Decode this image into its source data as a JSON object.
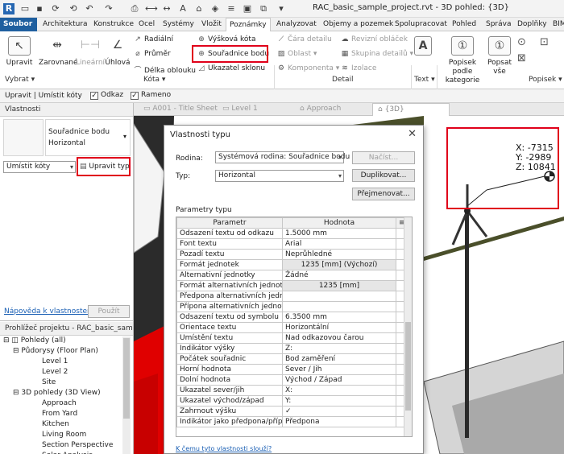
{
  "window": {
    "title": "RAC_basic_sample_project.rvt - 3D pohled: {3D}"
  },
  "tabs": [
    "Soubor",
    "Architektura",
    "Konstrukce",
    "Ocel",
    "Systémy",
    "Vložit",
    "Poznámky",
    "Analyzovat",
    "Objemy a pozemek",
    "Spolupracovat",
    "Pohled",
    "Správa",
    "Doplňky",
    "BIM"
  ],
  "active_tab": "Poznámky",
  "ribbon": {
    "upravit": "Upravit",
    "vybrat": "Vybrat",
    "kota": {
      "zarovnane": "Zarovnané",
      "linearni": "Lineární",
      "uhlova": "Úhlová",
      "radialni": "Radiální",
      "prumer": "Průměr",
      "delka_oblouku": "Délka oblouku",
      "vyskova_kota": "Výšková kóta",
      "souradnice_bodu": "Souřadnice bodu",
      "ukazatel_sklonu": "Ukazatel sklonu",
      "group": "Kóta"
    },
    "detail": {
      "cara_detailu": "Čára detailu",
      "oblast": "Oblast",
      "komponenta": "Komponenta",
      "revizni_oblacek": "Revizní obláček",
      "skupina_detailu": "Skupina detailů",
      "izolace": "Izolace",
      "group": "Detail"
    },
    "text": {
      "label": "Text",
      "group": "Text"
    },
    "popisek": {
      "podle_kategorie": "Popisek podle kategorie",
      "popsat_vse": "Popsat vše",
      "group": "Popisek"
    }
  },
  "options_bar": {
    "context": "Upravit | Umístit kóty",
    "odkaz": "Odkaz",
    "rameno": "Rameno"
  },
  "properties": {
    "title": "Vlastnosti",
    "type_name": "Souřadnice bodu",
    "type_sub": "Horizontal",
    "instance_select": "Umístit kóty",
    "edit_type": "Upravit typ",
    "help_link": "Nápověda k vlastnostem",
    "apply": "Použít"
  },
  "browser": {
    "title": "Prohlížeč projektu - RAC_basic_sampl...",
    "items": [
      "Pohledy (all)",
      "Půdorysy (Floor Plan)",
      "Level 1",
      "Level 2",
      "Site",
      "3D pohledy (3D View)",
      "Approach",
      "From Yard",
      "Kitchen",
      "Living Room",
      "Section Perspective",
      "Solar Analysis"
    ]
  },
  "view_tabs": [
    "A001 - Title Sheet",
    "Level 1",
    "Approach",
    "{3D}"
  ],
  "annotation": {
    "x": "X: -7315",
    "y": "Y: -2989",
    "z": "Z: 10841"
  },
  "dialog": {
    "title": "Vlastnosti typu",
    "rodina_label": "Rodina:",
    "rodina_value": "Systémová rodina: Souřadnice bodu",
    "typ_label": "Typ:",
    "typ_value": "Horizontal",
    "nacist": "Načíst...",
    "duplikovat": "Duplikovat...",
    "prejmenovat": "Přejmenovat...",
    "params_title": "Parametry typu",
    "col_param": "Parametr",
    "col_value": "Hodnota",
    "rows": [
      [
        "Odsazení textu od odkazu",
        "1.5000 mm"
      ],
      [
        "Font textu",
        "Arial"
      ],
      [
        "Pozadí textu",
        "Neprůhledné"
      ],
      [
        "Formát jednotek",
        "1235 [mm] (Výchozí)"
      ],
      [
        "Alternativní jednotky",
        "Žádné"
      ],
      [
        "Formát alternativních jednotek",
        "1235 [mm]"
      ],
      [
        "Předpona alternativních jednotek",
        ""
      ],
      [
        "Přípona alternativních jednotek",
        ""
      ],
      [
        "Odsazení textu od symbolu",
        "6.3500 mm"
      ],
      [
        "Orientace textu",
        "Horizontální"
      ],
      [
        "Umístění textu",
        "Nad odkazovou čarou"
      ],
      [
        "Indikátor výšky",
        "Z:"
      ],
      [
        "Počátek souřadnic",
        "Bod zaměření"
      ],
      [
        "Horní hodnota",
        "Sever / Jih"
      ],
      [
        "Dolní hodnota",
        "Východ / Západ"
      ],
      [
        "Ukazatel sever/jih",
        "X:"
      ],
      [
        "Ukazatel východ/západ",
        "Y:"
      ],
      [
        "Zahrnout výšku",
        "✓"
      ],
      [
        "Indikátor jako předpona/přípona",
        "Předpona"
      ]
    ],
    "help_link": "K čemu tyto vlastnosti slouží?"
  },
  "colors": {
    "highlight": "#e0001a",
    "file_tab": "#1f5f9f",
    "terrain": "#4a4f2a",
    "red_roof": "#e00000"
  }
}
